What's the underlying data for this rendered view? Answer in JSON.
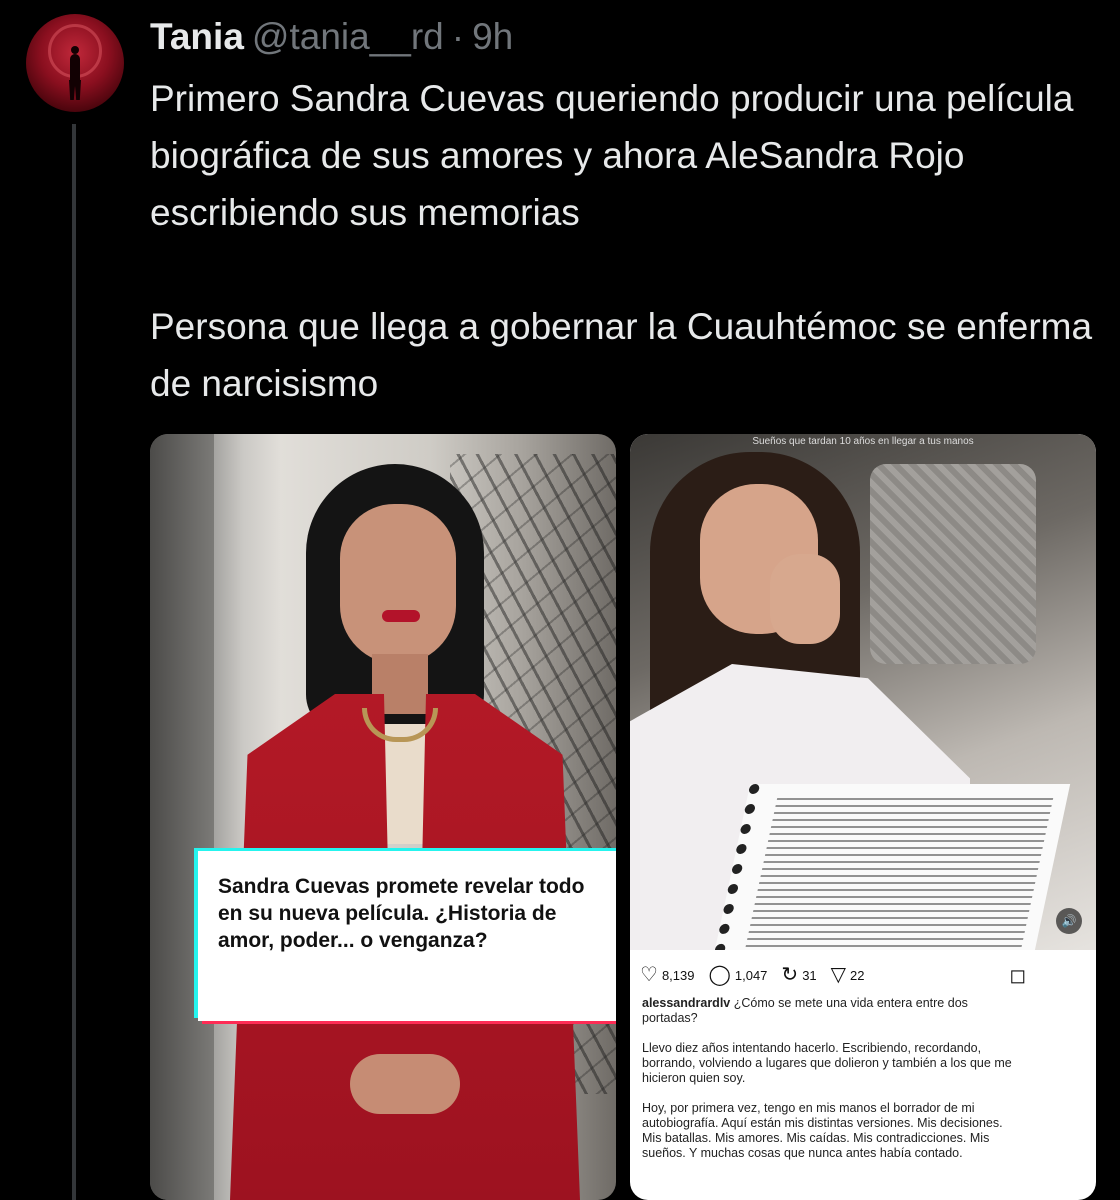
{
  "author": {
    "name": "Tania",
    "handle": "@tania__rd",
    "separator": "·",
    "time": "9h"
  },
  "tweet": {
    "paragraph1": "Primero Sandra Cuevas queriendo producir una película biográfica de sus amores y ahora AleSandra Rojo escribiendo sus memorias",
    "paragraph2": "Persona que llega a gobernar la Cuauhtémoc se enferma de narcisismo"
  },
  "media_left": {
    "overlay_text": "Sandra Cuevas promete revelar todo en su nueva película. ¿Historia de amor, poder... o venganza?"
  },
  "media_right": {
    "photo_caption": "Sueños que tardan 10 años en llegar a tus manos",
    "mute_icon": "speaker-icon",
    "likes": "8,139",
    "comments": "1,047",
    "reposts": "31",
    "shares": "22",
    "username": "alessandrardlv",
    "caption_line1": "¿Cómo se mete una vida entera entre dos portadas?",
    "caption_p2": "Llevo diez años intentando hacerlo. Escribiendo, recordando, borrando, volviendo a lugares que dolieron y también a los que me hicieron quien soy.",
    "caption_p3": "Hoy, por primera vez, tengo en mis manos el borrador de mi autobiografía. Aquí están mis distintas versiones. Mis decisiones. Mis batallas. Mis amores. Mis caídas. Mis contradicciones. Mis sueños. Y muchas cosas que nunca antes había contado."
  },
  "colors": {
    "background": "#000000",
    "text": "#e7e9ea",
    "secondary": "#71767b",
    "tiktok_cyan": "#25f4ee",
    "tiktok_red": "#fe2c55"
  }
}
